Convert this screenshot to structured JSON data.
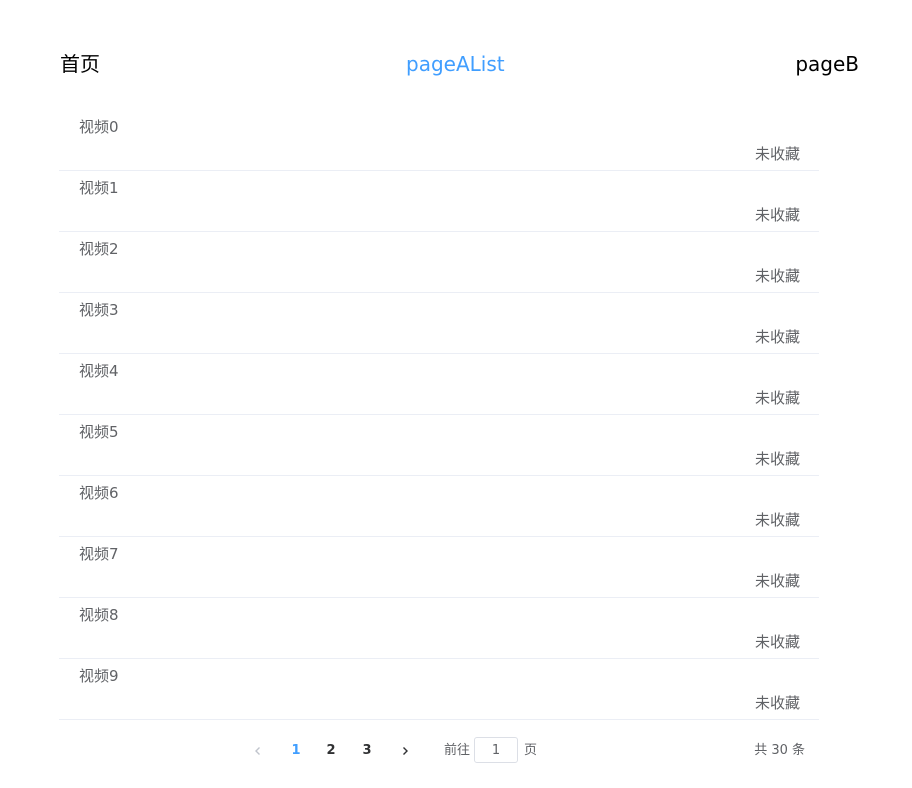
{
  "nav": {
    "home": "首页",
    "page_a": "pageAList",
    "page_b": "pageB",
    "active_color": "#409eff"
  },
  "list": {
    "items": [
      {
        "title": "视频0",
        "status": "未收藏"
      },
      {
        "title": "视频1",
        "status": "未收藏"
      },
      {
        "title": "视频2",
        "status": "未收藏"
      },
      {
        "title": "视频3",
        "status": "未收藏"
      },
      {
        "title": "视频4",
        "status": "未收藏"
      },
      {
        "title": "视频5",
        "status": "未收藏"
      },
      {
        "title": "视频6",
        "status": "未收藏"
      },
      {
        "title": "视频7",
        "status": "未收藏"
      },
      {
        "title": "视频8",
        "status": "未收藏"
      },
      {
        "title": "视频9",
        "status": "未收藏"
      }
    ]
  },
  "pagination": {
    "prev_icon": "chevron-left-icon",
    "next_icon": "chevron-right-icon",
    "pages": [
      "1",
      "2",
      "3"
    ],
    "current_page": "1",
    "jump_prefix": "前往",
    "jump_value": "1",
    "jump_suffix": "页",
    "total": "共 30 条"
  }
}
